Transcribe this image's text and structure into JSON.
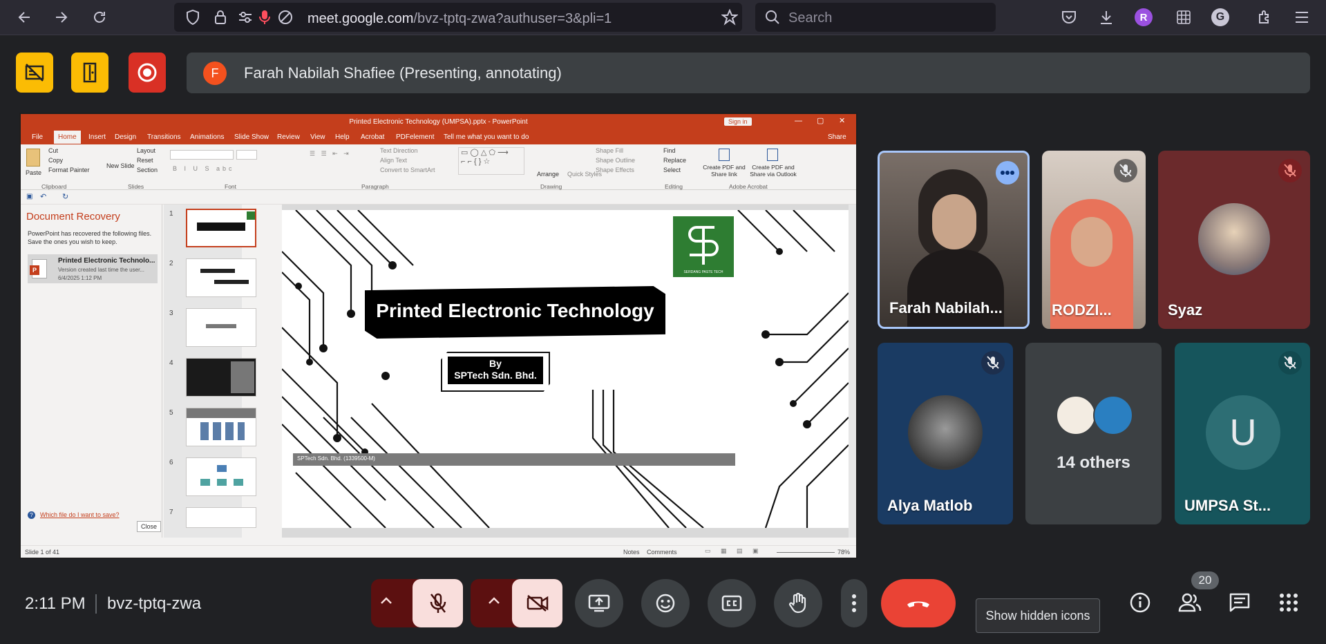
{
  "browser": {
    "url_domain": "meet.google.com",
    "url_path": "/bvz-tptq-zwa?authuser=3&pli=1",
    "search_placeholder": "Search",
    "profile_initial": "R"
  },
  "presenter": {
    "avatar_initial": "F",
    "label": "Farah Nabilah Shafiee (Presenting, annotating)"
  },
  "powerpoint": {
    "window_title": "Printed Electronic Technology (UMPSA).pptx  -  PowerPoint",
    "sign_in": "Sign in",
    "share": "Share",
    "tabs": [
      "File",
      "Home",
      "Insert",
      "Design",
      "Transitions",
      "Animations",
      "Slide Show",
      "Review",
      "View",
      "Help",
      "Acrobat",
      "PDFelement",
      "Tell me what you want to do"
    ],
    "ribbon": {
      "clipboard": [
        "Paste",
        "Cut",
        "Copy",
        "Format Painter"
      ],
      "slides": [
        "New Slide",
        "Layout",
        "Reset",
        "Section"
      ],
      "editing": [
        "Find",
        "Replace",
        "Select"
      ],
      "drawing": [
        "Arrange",
        "Quick Styles",
        "Shape Fill",
        "Shape Outline",
        "Shape Effects"
      ],
      "paragraph": [
        "Text Direction",
        "Align Text",
        "Convert to SmartArt"
      ],
      "acrobat": [
        "Create PDF and Share link",
        "Create PDF and Share via Outlook"
      ],
      "groups": [
        "Clipboard",
        "Slides",
        "Font",
        "Paragraph",
        "Drawing",
        "Editing",
        "Adobe Acrobat"
      ]
    },
    "recovery": {
      "title": "Document Recovery",
      "description": "PowerPoint has recovered the following files. Save the ones you wish to keep.",
      "file_name": "Printed Electronic Technolo...",
      "file_desc": "Version created last time the user...",
      "file_date": "6/4/2025 1:12 PM",
      "help_link": "Which file do I want to save?",
      "close": "Close"
    },
    "thumbnail_numbers": [
      "1",
      "2",
      "3",
      "4",
      "5",
      "6",
      "7"
    ],
    "slide": {
      "title": "Printed Electronic Technology",
      "by": "By",
      "company": "SPTech Sdn. Bhd.",
      "logo_text": "SERDANG PASTE TECH",
      "footer": "SPTech Sdn. Bhd. (1339500-M)"
    },
    "status": {
      "slide_info": "Slide 1 of 41",
      "notes": "Notes",
      "comments": "Comments",
      "zoom": "78%"
    }
  },
  "participants": [
    {
      "name": "Farah Nabilah...",
      "state": "speaking"
    },
    {
      "name": "RODZI...",
      "state": "muted"
    },
    {
      "name": "Syaz",
      "state": "muted"
    },
    {
      "name": "Alya Matlob",
      "state": "muted"
    },
    {
      "name": "14 others",
      "state": "group"
    },
    {
      "name": "UMPSA St...",
      "state": "muted",
      "initial": "U"
    }
  ],
  "bottom": {
    "time": "2:11 PM",
    "meeting_code": "bvz-tptq-zwa",
    "tooltip": "Show hidden icons",
    "people_count": "20"
  },
  "colors": {
    "accent_red": "#ea4335",
    "dark_red": "#5c1010",
    "yellow": "#fbbc04",
    "ppt_orange": "#c43e1c"
  }
}
